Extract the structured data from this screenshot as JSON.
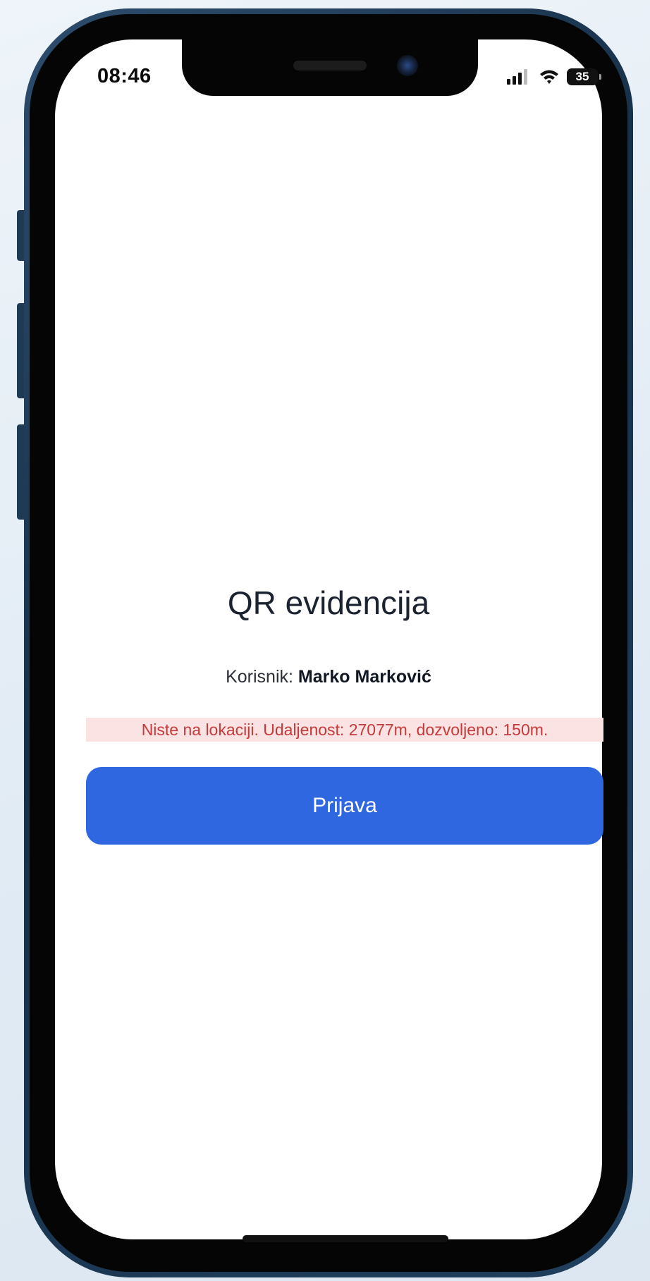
{
  "status_bar": {
    "time": "08:46",
    "battery": "35",
    "icons": [
      "signal-icon",
      "wifi-icon",
      "battery-icon"
    ]
  },
  "screen": {
    "title": "QR evidencija",
    "user_label": "Korisnik:",
    "user_name": "Marko Marković",
    "error_message": "Niste na lokaciji. Udaljenost: 27077m, dozvoljeno: 150m.",
    "login_button_label": "Prijava"
  },
  "colors": {
    "accent": "#2f67e0",
    "error_text": "#c53a3a",
    "error_background": "#fbe3e3",
    "phone_frame": "#1f3a55"
  }
}
